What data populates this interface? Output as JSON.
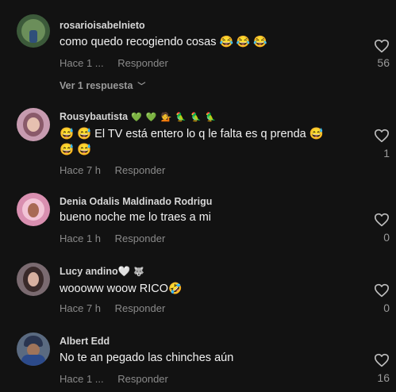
{
  "comments": [
    {
      "username": "rosarioisabelnieto",
      "username_emojis": "",
      "text": "como quedo recogiendo cosas",
      "text_emojis": "😂 😂 😂",
      "text_line2": "",
      "time": "Hace 1 ...",
      "reply_label": "Responder",
      "likes": "56"
    },
    {
      "username": "Rousybautista",
      "username_emojis": "💚 💚 💁 🦜 🦜 🦜",
      "text": "😅 😅 El TV está entero lo q le falta es q prenda 😅",
      "text_emojis": "",
      "text_line2": "😅 😅",
      "time": "Hace 7 h",
      "reply_label": "Responder",
      "likes": "1"
    },
    {
      "username": "Denia Odalis Maldinado Rodrigu",
      "username_emojis": "",
      "text": "bueno noche me lo traes a mi",
      "text_emojis": "",
      "text_line2": "",
      "time": "Hace 1 h",
      "reply_label": "Responder",
      "likes": "0"
    },
    {
      "username": "Lucy andino🤍",
      "username_emojis": "🐺",
      "text": "woooww woow RICO",
      "text_emojis": "🤣",
      "text_line2": "",
      "time": "Hace 7 h",
      "reply_label": "Responder",
      "likes": "0"
    },
    {
      "username": "Albert Edd",
      "username_emojis": "",
      "text": "No te an pegado las chinches aún",
      "text_emojis": "",
      "text_line2": "",
      "time": "Hace 1 ...",
      "reply_label": "Responder",
      "likes": "16"
    }
  ],
  "view_replies": "Ver 1 respuesta",
  "icons": {
    "like": "heart-outline-icon",
    "expand": "chevron-down-icon"
  },
  "colors": {
    "background": "#121212",
    "muted": "#8a8a8a"
  }
}
